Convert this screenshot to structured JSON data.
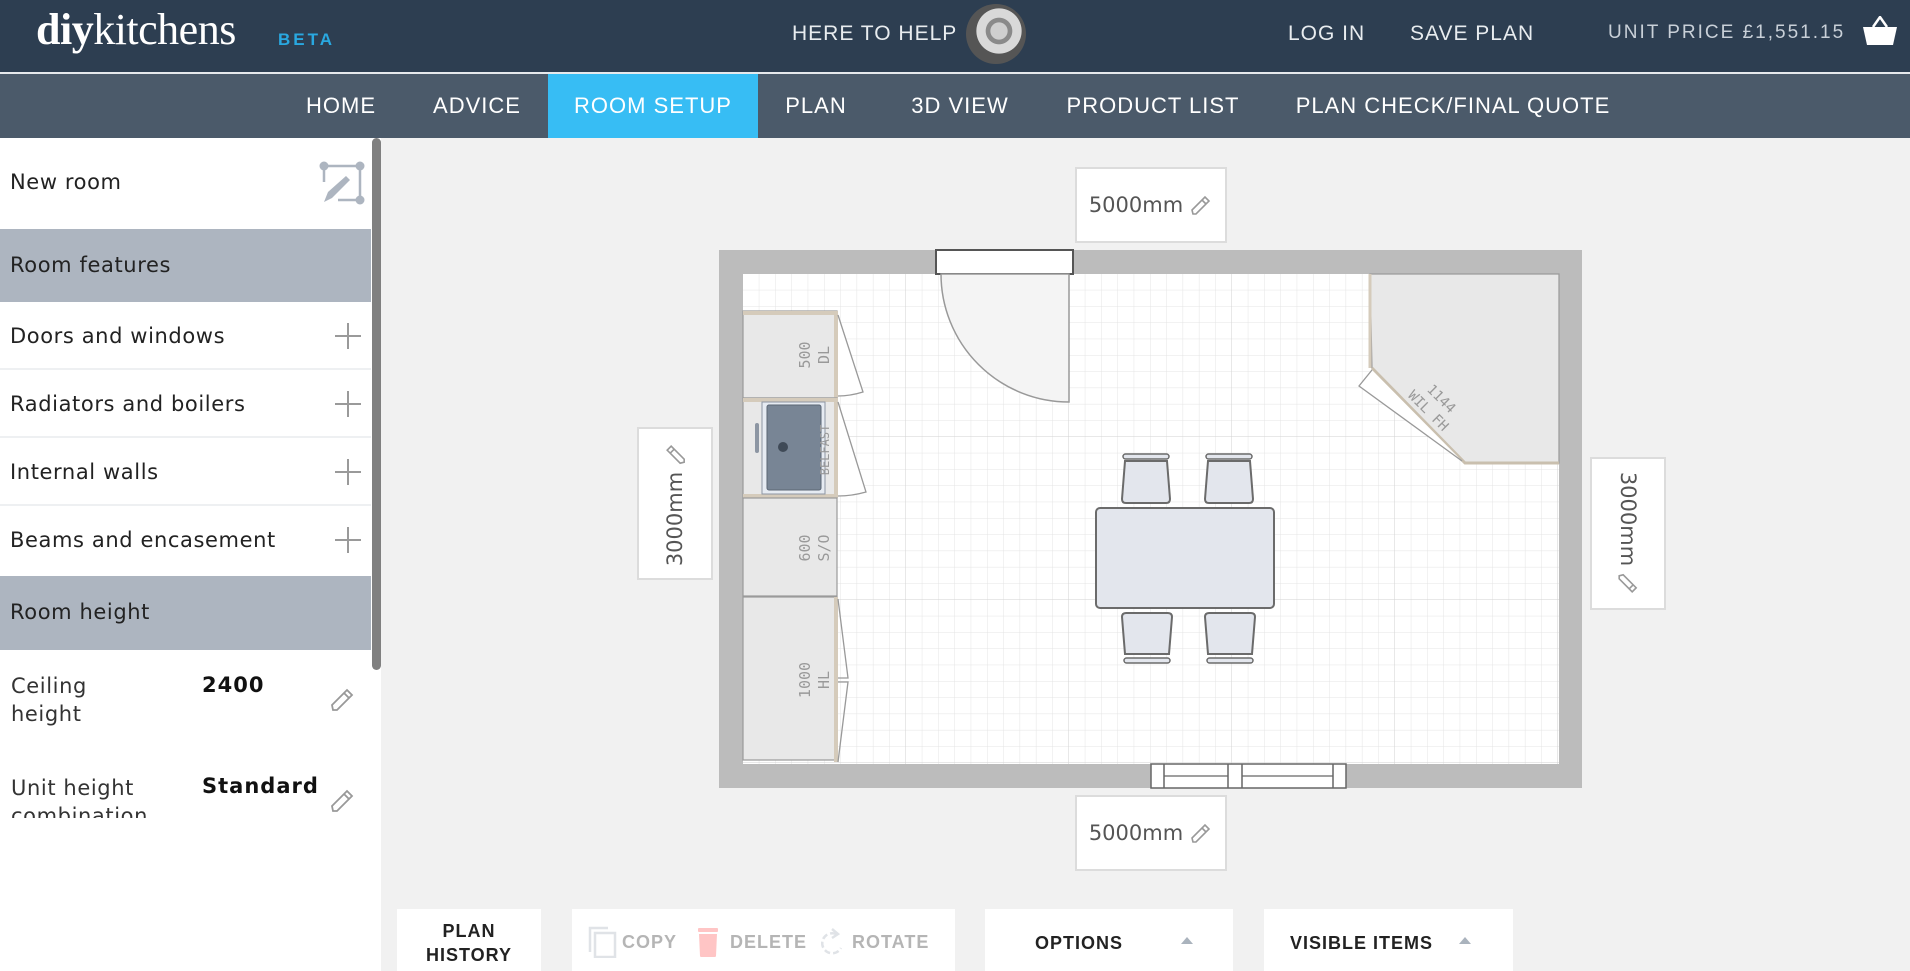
{
  "header": {
    "logo_bold": "diy",
    "logo_rest": "kitchens",
    "logo_badge": "BETA",
    "help_label": "HERE TO HELP",
    "login_label": "LOG IN",
    "save_plan_label": "SAVE PLAN",
    "unit_price_label": "UNIT PRICE £1,551.15"
  },
  "nav": {
    "items": [
      {
        "label": "HOME"
      },
      {
        "label": "ADVICE"
      },
      {
        "label": "ROOM SETUP",
        "active": true
      },
      {
        "label": "PLAN"
      },
      {
        "label": "3D VIEW"
      },
      {
        "label": "PRODUCT LIST"
      },
      {
        "label": "PLAN CHECK/FINAL QUOTE"
      }
    ],
    "active_color": "#37bdf4"
  },
  "sidebar": {
    "new_room_label": "New room",
    "room_features_heading": "Room features",
    "feature_items": [
      {
        "label": "Doors and windows"
      },
      {
        "label": "Radiators and boilers"
      },
      {
        "label": "Internal walls"
      },
      {
        "label": "Beams and encasement"
      }
    ],
    "room_height_heading": "Room height",
    "properties": [
      {
        "label": "Ceiling height",
        "value": "2400"
      },
      {
        "label": "Unit height combination",
        "value": "Standard"
      }
    ]
  },
  "plan": {
    "dimensions": {
      "top": "5000mm",
      "bottom": "5000mm",
      "left": "3000mm",
      "right": "3000mm"
    },
    "units": [
      {
        "label_line1": "500",
        "label_line2": "DL"
      },
      {
        "label_line1": "",
        "label_line2": "BELFAST"
      },
      {
        "label_line1": "600",
        "label_line2": "S/O"
      },
      {
        "label_line1": "1000",
        "label_line2": "HL"
      },
      {
        "label_line1": "1144",
        "label_line2": "WIL FH"
      }
    ]
  },
  "toolbar": {
    "plan_history_line1": "PLAN",
    "plan_history_line2": "HISTORY",
    "copy_label": "COPY",
    "delete_label": "DELETE",
    "rotate_label": "ROTATE",
    "options_label": "OPTIONS",
    "visible_items_label": "VISIBLE ITEMS"
  }
}
